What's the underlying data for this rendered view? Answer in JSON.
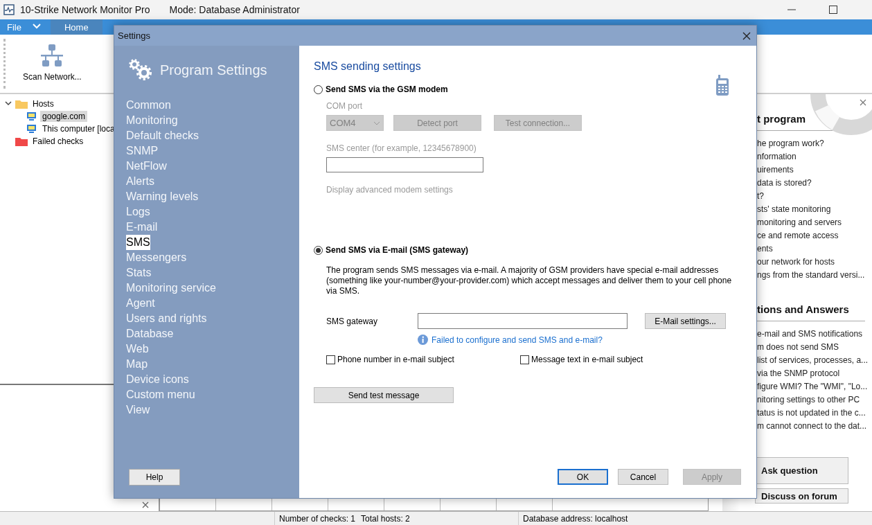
{
  "window": {
    "title": "10-Strike Network Monitor Pro",
    "mode": "Mode: Database Administrator"
  },
  "menu": [
    {
      "label": "File",
      "selected": false
    },
    {
      "label": "Home",
      "selected": true
    }
  ],
  "ribbon": [
    {
      "label": "Scan Network..."
    }
  ],
  "tree": [
    {
      "label": "Hosts",
      "kind": "folder",
      "expanded": true,
      "selected": false,
      "children": [
        {
          "label": "google.com",
          "kind": "host",
          "selected": true
        },
        {
          "label": "This computer [loca",
          "kind": "host",
          "selected": false
        }
      ]
    },
    {
      "label": "Failed checks",
      "kind": "failed",
      "selected": false
    }
  ],
  "help_panel": {
    "heading_1": "t program",
    "links_1": [
      "he program work?",
      "nformation",
      "uirements",
      "data is stored?",
      "t?",
      "sts' state monitoring",
      " monitoring and servers",
      "ce and remote access",
      "ents",
      "our network for hosts",
      "ngs from the standard versi..."
    ],
    "heading_2": "tions and Answers",
    "links_2": [
      "e-mail and SMS notifications",
      "m does not send SMS",
      " list of services, processes, a...",
      " via the SNMP protocol",
      "figure WMI? The \"WMI\", \"Lo...",
      "nitoring settings to other PC",
      "tatus is not updated in the c...",
      "m cannot connect to the dat..."
    ],
    "buttons": [
      "Ask question",
      "Discuss on forum"
    ]
  },
  "status_bar": [
    "Number of checks: 1",
    "Total hosts: 2",
    "Database address: localhost"
  ],
  "dialog": {
    "title": "Settings",
    "header": "Program Settings",
    "nav": [
      {
        "label": "Common",
        "selected": false
      },
      {
        "label": "Monitoring",
        "selected": false
      },
      {
        "label": "Default checks",
        "selected": false
      },
      {
        "label": "SNMP",
        "selected": false
      },
      {
        "label": "NetFlow",
        "selected": false
      },
      {
        "label": "Alerts",
        "selected": false
      },
      {
        "label": "Warning levels",
        "selected": false
      },
      {
        "label": "Logs",
        "selected": false
      },
      {
        "label": "E-mail",
        "selected": false
      },
      {
        "label": "SMS",
        "selected": true
      },
      {
        "label": "Messengers",
        "selected": false
      },
      {
        "label": "Stats",
        "selected": false
      },
      {
        "label": "Monitoring service",
        "selected": false
      },
      {
        "label": "Agent",
        "selected": false
      },
      {
        "label": "Users and rights",
        "selected": false
      },
      {
        "label": "Database",
        "selected": false
      },
      {
        "label": "Web",
        "selected": false
      },
      {
        "label": "Map",
        "selected": false
      },
      {
        "label": "Device icons",
        "selected": false
      },
      {
        "label": "Custom menu",
        "selected": false
      },
      {
        "label": "View",
        "selected": false
      }
    ],
    "help_button": "Help",
    "heading": "SMS sending settings",
    "options": [
      {
        "label": "Send SMS via the GSM modem",
        "selected": false
      },
      {
        "label": "Send SMS via E-mail (SMS gateway)",
        "selected": true
      }
    ],
    "modem": {
      "disabled": true,
      "com_port_label": "COM port",
      "com_port_value": "COM4",
      "detect_button": "Detect port",
      "test_button": "Test connection...",
      "sms_center_label": "SMS center (for example, 12345678900)",
      "advanced_link": "Display advanced modem settings"
    },
    "gateway": {
      "description": "The program sends SMS messages via e-mail. A majority of GSM providers have special e-mail addresses (something like your-number@your-provider.com) which accept messages and deliver them to your cell phone via SMS.",
      "gateway_label": "SMS gateway",
      "email_settings_button": "E-Mail settings...",
      "help_link": "Failed to configure and send SMS and e-mail?",
      "checkboxes": [
        {
          "label": "Phone number in e-mail subject",
          "checked": false
        },
        {
          "label": "Message text in e-mail subject",
          "checked": false
        }
      ],
      "test_button": "Send test message"
    },
    "buttons": [
      {
        "label": "OK",
        "kind": "default",
        "disabled": false
      },
      {
        "label": "Cancel",
        "kind": "normal",
        "disabled": false
      },
      {
        "label": "Apply",
        "kind": "normal",
        "disabled": true
      }
    ]
  }
}
